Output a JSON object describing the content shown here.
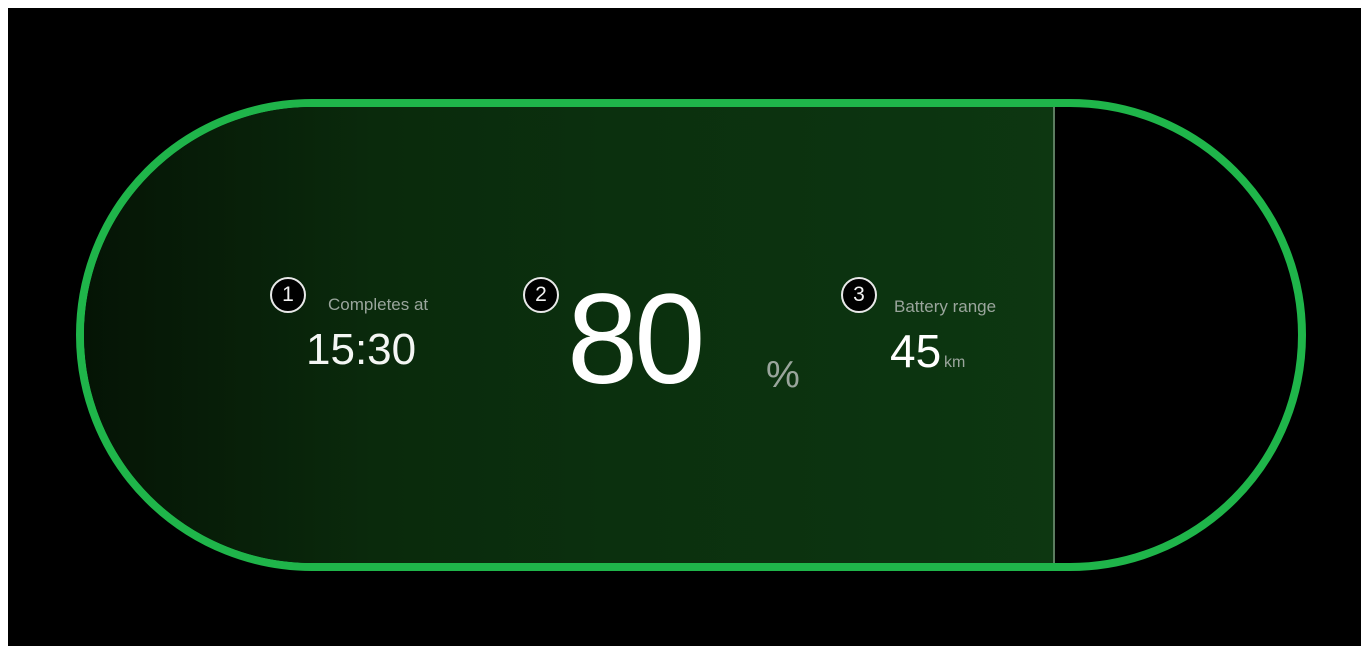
{
  "charging_status": {
    "charge_level_fraction": 0.8,
    "accent_color": "#1fb54a",
    "items": [
      {
        "marker": "1",
        "label": "Completes at",
        "value": "15:30"
      },
      {
        "marker": "2",
        "value": "80",
        "unit": "%"
      },
      {
        "marker": "3",
        "label": "Battery range",
        "value": "45",
        "unit": "km"
      }
    ]
  }
}
